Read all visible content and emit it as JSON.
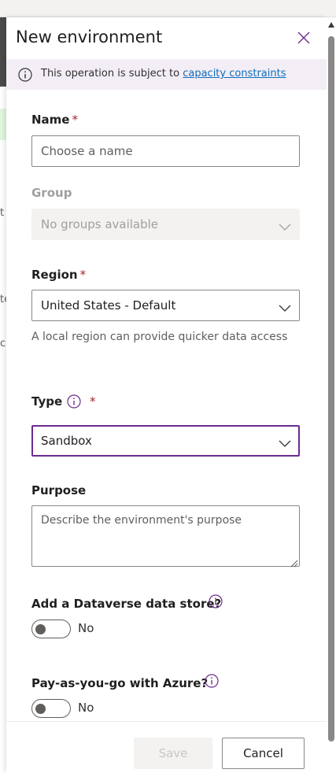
{
  "panel": {
    "title": "New environment",
    "close_icon": "close-icon"
  },
  "info_bar": {
    "text": "This operation is subject to",
    "link": "capacity constraints",
    "icon": "info-icon"
  },
  "background": {
    "chars": [
      "t",
      "te",
      "c"
    ]
  },
  "form": {
    "name": {
      "label": "Name",
      "required_mark": "*",
      "placeholder": "Choose a name",
      "value": ""
    },
    "group": {
      "label": "Group",
      "value": "No groups available",
      "disabled": true
    },
    "region": {
      "label": "Region",
      "required_mark": "*",
      "value": "United States - Default",
      "helper": "A local region can provide quicker data access"
    },
    "type": {
      "label": "Type",
      "required_mark": "*",
      "value": "Sandbox",
      "info_icon": "info-icon"
    },
    "purpose": {
      "label": "Purpose",
      "placeholder": "Describe the environment's purpose",
      "value": ""
    },
    "dataverse": {
      "label": "Add a Dataverse data store?",
      "toggle_text": "No",
      "on": false
    },
    "payg": {
      "label": "Pay-as-you-go with Azure?",
      "toggle_text": "No",
      "on": false
    }
  },
  "footer": {
    "save_label": "Save",
    "cancel_label": "Cancel"
  },
  "colors": {
    "accent": "#6b2c8f",
    "link": "#0f6cbd",
    "required": "#a4262c",
    "info_bar_bg": "#f3eef5"
  }
}
